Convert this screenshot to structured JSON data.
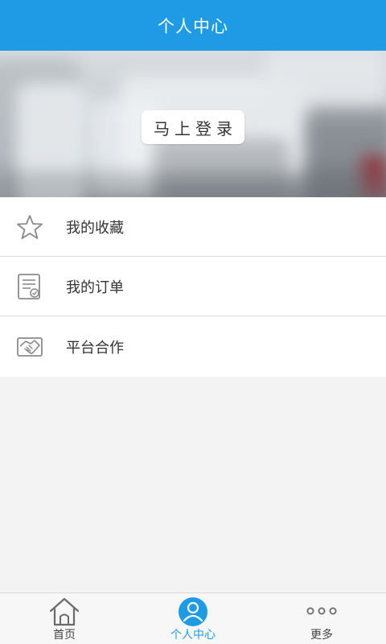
{
  "header": {
    "title": "个人中心"
  },
  "hero": {
    "login_label": "马上登录"
  },
  "menu": {
    "items": [
      {
        "label": "我的收藏",
        "icon": "star-icon"
      },
      {
        "label": "我的订单",
        "icon": "order-list-icon"
      },
      {
        "label": "平台合作",
        "icon": "handshake-icon"
      }
    ]
  },
  "tabbar": {
    "tabs": [
      {
        "label": "首页",
        "icon": "home-icon",
        "active": false
      },
      {
        "label": "个人中心",
        "icon": "user-icon",
        "active": true
      },
      {
        "label": "更多",
        "icon": "more-dots-icon",
        "active": false
      }
    ]
  },
  "colors": {
    "accent": "#1e9be4",
    "background": "#f3f3f3",
    "text": "#333333",
    "icon": "#8a8a8a"
  }
}
